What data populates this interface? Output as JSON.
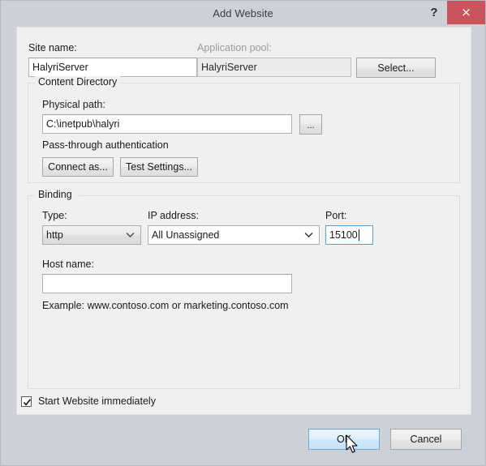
{
  "window": {
    "title": "Add Website",
    "help_label": "?",
    "close_label": "×"
  },
  "site": {
    "site_name_label": "Site name:",
    "site_name_value": "HalyriServer",
    "app_pool_label": "Application pool:",
    "app_pool_value": "HalyriServer",
    "select_button": "Select..."
  },
  "content_directory": {
    "group_title": "Content Directory",
    "physical_path_label": "Physical path:",
    "physical_path_value": "C:\\inetpub\\halyri",
    "browse_button": "...",
    "auth_text": "Pass-through authentication",
    "connect_as_button": "Connect as...",
    "test_settings_button": "Test Settings..."
  },
  "binding": {
    "group_title": "Binding",
    "type_label": "Type:",
    "type_value": "http",
    "ip_label": "IP address:",
    "ip_value": "All Unassigned",
    "port_label": "Port:",
    "port_value": "15100",
    "host_name_label": "Host name:",
    "host_name_value": "",
    "example_text": "Example: www.contoso.com or marketing.contoso.com"
  },
  "footer": {
    "start_immediately_label": "Start Website immediately",
    "start_immediately_checked": true,
    "ok_button": "OK",
    "cancel_button": "Cancel"
  },
  "colors": {
    "titlebar": "#ccd1d9",
    "close_red": "#c9545d",
    "panel": "#f0f0f0",
    "focus_blue": "#5a9fd4"
  }
}
